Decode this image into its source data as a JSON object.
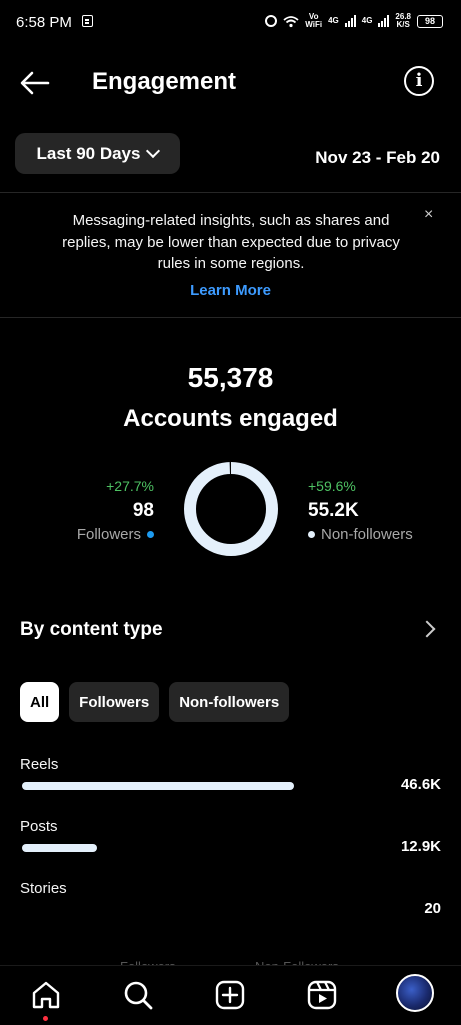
{
  "status_bar": {
    "time": "6:58 PM",
    "vo_wifi": "Vo\nWiFi",
    "net1": "4G",
    "net2": "4G",
    "speed": "26.8\nK/S",
    "battery": "98"
  },
  "header": {
    "title": "Engagement"
  },
  "range": {
    "label": "Last 90 Days",
    "dates": "Nov 23 - Feb 20"
  },
  "notice": {
    "text": "Messaging-related insights, such as shares and replies, may be lower than expected due to privacy rules in some regions.",
    "link": "Learn More",
    "close": "×"
  },
  "summary": {
    "total": "55,378",
    "label": "Accounts engaged",
    "followers": {
      "change": "+27.7%",
      "value": "98",
      "label": "Followers",
      "color": "#1d9bf0",
      "share": 0.0018
    },
    "non_followers": {
      "change": "+59.6%",
      "value": "55.2K",
      "label": "Non-followers",
      "color": "#e4f0fb",
      "share": 0.9982
    }
  },
  "content_type": {
    "title": "By content type",
    "filters": [
      "All",
      "Followers",
      "Non-followers"
    ],
    "active_filter": "All",
    "rows": [
      {
        "label": "Reels",
        "value": "46.6K",
        "fraction": 0.98
      },
      {
        "label": "Posts",
        "value": "12.9K",
        "fraction": 0.27
      },
      {
        "label": "Stories",
        "value": "20",
        "fraction": 0.0
      }
    ]
  },
  "faded_legend": {
    "left": "Followers",
    "right": "Non-Followers"
  },
  "colors": {
    "accent_blue": "#3d9bff",
    "positive_green": "#4ec163",
    "bar": "#e4f0fb"
  }
}
